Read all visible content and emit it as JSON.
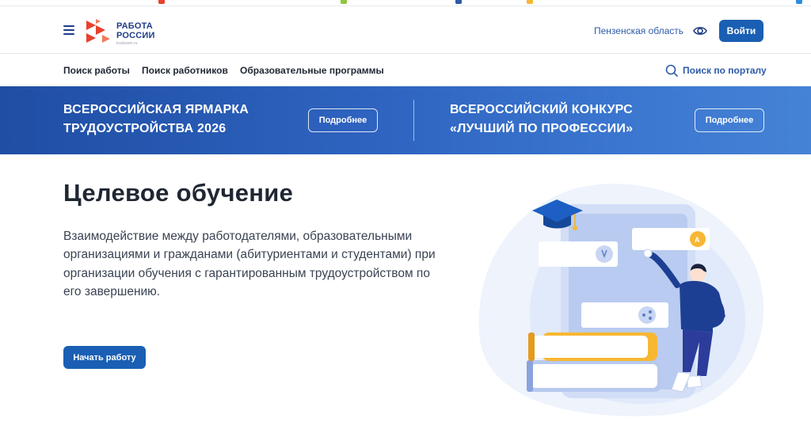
{
  "header": {
    "logo_line1": "РАБОТА",
    "logo_line2": "РОССИИ",
    "logo_sub": "trudvsem.ru",
    "region": "Пензенская область",
    "login_label": "Войти",
    "menu_icon": "hamburger-icon",
    "accessibility_icon": "eye-icon"
  },
  "nav": {
    "items": [
      "Поиск работы",
      "Поиск работников",
      "Образовательные программы"
    ],
    "search_label": "Поиск по порталу",
    "search_icon": "search-icon"
  },
  "banner": {
    "left_line1": "ВСЕРОССИЙСКАЯ ЯРМАРКА",
    "left_line2": "ТРУДОУСТРОЙСТВА 2026",
    "left_button": "Подробнее",
    "right_line1": "ВСЕРОССИЙСКИЙ КОНКУРС",
    "right_line2": "«ЛУЧШИЙ ПО ПРОФЕССИИ»",
    "right_button": "Подробнее"
  },
  "hero": {
    "title": "Целевое обучение",
    "description": "Взаимодействие между работодателями, образовательными организациями и гражданами (абитуриентами и студентами) при организации обучения с гарантированным трудоустройством по его завершению.",
    "button_label": "Начать работу",
    "illustration_icons": [
      "graduation-cap-icon",
      "medal-icon",
      "language-icon",
      "share-icon"
    ]
  },
  "colors": {
    "primary": "#1a5fb4",
    "brand_dark": "#1f3c88",
    "logo_red": "#e8412c",
    "banner_start": "#1f4ea4",
    "banner_end": "#4583d6",
    "accent_yellow": "#f7b733"
  }
}
